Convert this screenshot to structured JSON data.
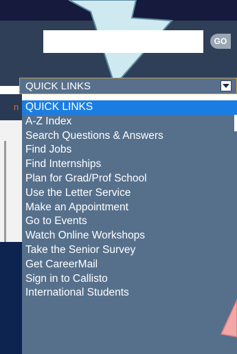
{
  "search": {
    "value": "",
    "go_label": "GO"
  },
  "quick_links": {
    "selected": "QUICK LINKS",
    "options": [
      "QUICK LINKS",
      "A-Z Index",
      "Search Questions & Answers",
      "Find Jobs",
      "Find Internships",
      "Plan for Grad/Prof School",
      "Use the Letter Service",
      "Make an Appointment",
      "Go to Events",
      "Watch Online Workshops",
      "Take the Senior Survey",
      "Get CareerMail",
      "Sign in to Callisto",
      "International Students"
    ]
  },
  "page_fragment": {
    "cut_text": "n"
  },
  "colors": {
    "header_dark": "#161a3d",
    "header": "#2e3f57",
    "dropdown_bg": "#56708c",
    "highlight": "#1a7de3",
    "select_border": "#c8a23c",
    "callout": "#cfe9f0",
    "pink_callout": "#f2a7a8",
    "left_accent": "#d9712a"
  },
  "icons": {
    "callout": "callout-arrow-icon",
    "dropdown": "chevron-down-icon",
    "decor": "pink-callout-shape"
  }
}
